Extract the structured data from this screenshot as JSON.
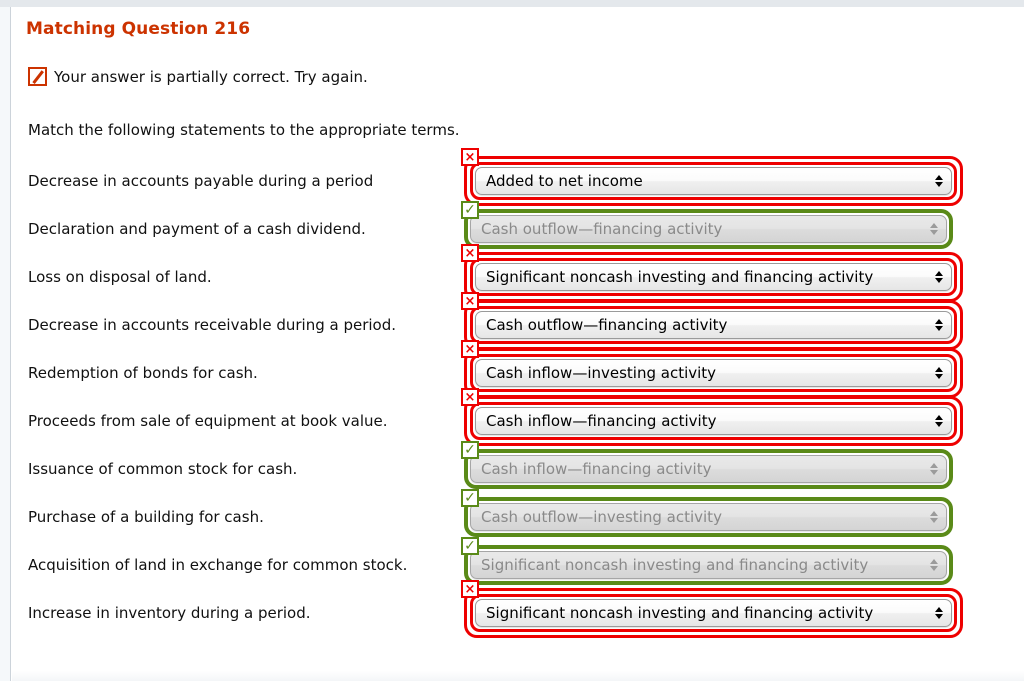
{
  "question": {
    "title": "Matching Question 216",
    "feedback": {
      "icon": "partial-correct-icon",
      "text": "Your answer is partially correct.  Try again."
    },
    "instructions": "Match the following statements to the appropriate terms."
  },
  "rows": [
    {
      "statement": "Decrease in accounts payable during a period",
      "answer": "Added to net income",
      "status": "incorrect",
      "status_glyph": "×",
      "disabled": false
    },
    {
      "statement": "Declaration and payment of a cash dividend.",
      "answer": "Cash outflow—financing activity",
      "status": "correct",
      "status_glyph": "✓",
      "disabled": true
    },
    {
      "statement": "Loss on disposal of land.",
      "answer": "Significant noncash investing and financing activity",
      "status": "incorrect",
      "status_glyph": "×",
      "disabled": false
    },
    {
      "statement": "Decrease in accounts receivable during a period.",
      "answer": "Cash outflow—financing activity",
      "status": "incorrect",
      "status_glyph": "×",
      "disabled": false
    },
    {
      "statement": "Redemption of bonds for cash.",
      "answer": "Cash inflow—investing activity",
      "status": "incorrect",
      "status_glyph": "×",
      "disabled": false
    },
    {
      "statement": "Proceeds from sale of equipment at book value.",
      "answer": "Cash inflow—financing activity",
      "status": "incorrect",
      "status_glyph": "×",
      "disabled": false
    },
    {
      "statement": "Issuance of common stock for cash.",
      "answer": "Cash inflow—financing activity",
      "status": "correct",
      "status_glyph": "✓",
      "disabled": true
    },
    {
      "statement": "Purchase of a building for cash.",
      "answer": "Cash outflow—investing activity",
      "status": "correct",
      "status_glyph": "✓",
      "disabled": true
    },
    {
      "statement": "Acquisition of land in exchange for common stock.",
      "answer": "Significant noncash investing and financing activity",
      "status": "correct",
      "status_glyph": "✓",
      "disabled": true
    },
    {
      "statement": "Increase in inventory during a period.",
      "answer": "Significant noncash investing and financing activity",
      "status": "incorrect",
      "status_glyph": "×",
      "disabled": false
    }
  ],
  "colors": {
    "title": "#cc3300",
    "incorrect": "#ee0000",
    "correct": "#5a8a18",
    "text": "#111111",
    "disabled_text": "#8a8a8a"
  }
}
